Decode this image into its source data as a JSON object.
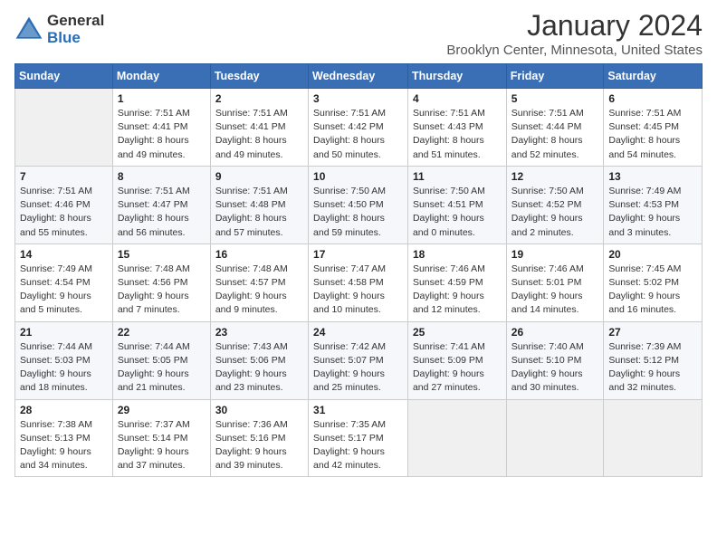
{
  "logo": {
    "general": "General",
    "blue": "Blue"
  },
  "title": "January 2024",
  "location": "Brooklyn Center, Minnesota, United States",
  "days_of_week": [
    "Sunday",
    "Monday",
    "Tuesday",
    "Wednesday",
    "Thursday",
    "Friday",
    "Saturday"
  ],
  "weeks": [
    [
      {
        "num": "",
        "info": ""
      },
      {
        "num": "1",
        "info": "Sunrise: 7:51 AM\nSunset: 4:41 PM\nDaylight: 8 hours\nand 49 minutes."
      },
      {
        "num": "2",
        "info": "Sunrise: 7:51 AM\nSunset: 4:41 PM\nDaylight: 8 hours\nand 49 minutes."
      },
      {
        "num": "3",
        "info": "Sunrise: 7:51 AM\nSunset: 4:42 PM\nDaylight: 8 hours\nand 50 minutes."
      },
      {
        "num": "4",
        "info": "Sunrise: 7:51 AM\nSunset: 4:43 PM\nDaylight: 8 hours\nand 51 minutes."
      },
      {
        "num": "5",
        "info": "Sunrise: 7:51 AM\nSunset: 4:44 PM\nDaylight: 8 hours\nand 52 minutes."
      },
      {
        "num": "6",
        "info": "Sunrise: 7:51 AM\nSunset: 4:45 PM\nDaylight: 8 hours\nand 54 minutes."
      }
    ],
    [
      {
        "num": "7",
        "info": "Sunrise: 7:51 AM\nSunset: 4:46 PM\nDaylight: 8 hours\nand 55 minutes."
      },
      {
        "num": "8",
        "info": "Sunrise: 7:51 AM\nSunset: 4:47 PM\nDaylight: 8 hours\nand 56 minutes."
      },
      {
        "num": "9",
        "info": "Sunrise: 7:51 AM\nSunset: 4:48 PM\nDaylight: 8 hours\nand 57 minutes."
      },
      {
        "num": "10",
        "info": "Sunrise: 7:50 AM\nSunset: 4:50 PM\nDaylight: 8 hours\nand 59 minutes."
      },
      {
        "num": "11",
        "info": "Sunrise: 7:50 AM\nSunset: 4:51 PM\nDaylight: 9 hours\nand 0 minutes."
      },
      {
        "num": "12",
        "info": "Sunrise: 7:50 AM\nSunset: 4:52 PM\nDaylight: 9 hours\nand 2 minutes."
      },
      {
        "num": "13",
        "info": "Sunrise: 7:49 AM\nSunset: 4:53 PM\nDaylight: 9 hours\nand 3 minutes."
      }
    ],
    [
      {
        "num": "14",
        "info": "Sunrise: 7:49 AM\nSunset: 4:54 PM\nDaylight: 9 hours\nand 5 minutes."
      },
      {
        "num": "15",
        "info": "Sunrise: 7:48 AM\nSunset: 4:56 PM\nDaylight: 9 hours\nand 7 minutes."
      },
      {
        "num": "16",
        "info": "Sunrise: 7:48 AM\nSunset: 4:57 PM\nDaylight: 9 hours\nand 9 minutes."
      },
      {
        "num": "17",
        "info": "Sunrise: 7:47 AM\nSunset: 4:58 PM\nDaylight: 9 hours\nand 10 minutes."
      },
      {
        "num": "18",
        "info": "Sunrise: 7:46 AM\nSunset: 4:59 PM\nDaylight: 9 hours\nand 12 minutes."
      },
      {
        "num": "19",
        "info": "Sunrise: 7:46 AM\nSunset: 5:01 PM\nDaylight: 9 hours\nand 14 minutes."
      },
      {
        "num": "20",
        "info": "Sunrise: 7:45 AM\nSunset: 5:02 PM\nDaylight: 9 hours\nand 16 minutes."
      }
    ],
    [
      {
        "num": "21",
        "info": "Sunrise: 7:44 AM\nSunset: 5:03 PM\nDaylight: 9 hours\nand 18 minutes."
      },
      {
        "num": "22",
        "info": "Sunrise: 7:44 AM\nSunset: 5:05 PM\nDaylight: 9 hours\nand 21 minutes."
      },
      {
        "num": "23",
        "info": "Sunrise: 7:43 AM\nSunset: 5:06 PM\nDaylight: 9 hours\nand 23 minutes."
      },
      {
        "num": "24",
        "info": "Sunrise: 7:42 AM\nSunset: 5:07 PM\nDaylight: 9 hours\nand 25 minutes."
      },
      {
        "num": "25",
        "info": "Sunrise: 7:41 AM\nSunset: 5:09 PM\nDaylight: 9 hours\nand 27 minutes."
      },
      {
        "num": "26",
        "info": "Sunrise: 7:40 AM\nSunset: 5:10 PM\nDaylight: 9 hours\nand 30 minutes."
      },
      {
        "num": "27",
        "info": "Sunrise: 7:39 AM\nSunset: 5:12 PM\nDaylight: 9 hours\nand 32 minutes."
      }
    ],
    [
      {
        "num": "28",
        "info": "Sunrise: 7:38 AM\nSunset: 5:13 PM\nDaylight: 9 hours\nand 34 minutes."
      },
      {
        "num": "29",
        "info": "Sunrise: 7:37 AM\nSunset: 5:14 PM\nDaylight: 9 hours\nand 37 minutes."
      },
      {
        "num": "30",
        "info": "Sunrise: 7:36 AM\nSunset: 5:16 PM\nDaylight: 9 hours\nand 39 minutes."
      },
      {
        "num": "31",
        "info": "Sunrise: 7:35 AM\nSunset: 5:17 PM\nDaylight: 9 hours\nand 42 minutes."
      },
      {
        "num": "",
        "info": ""
      },
      {
        "num": "",
        "info": ""
      },
      {
        "num": "",
        "info": ""
      }
    ]
  ]
}
